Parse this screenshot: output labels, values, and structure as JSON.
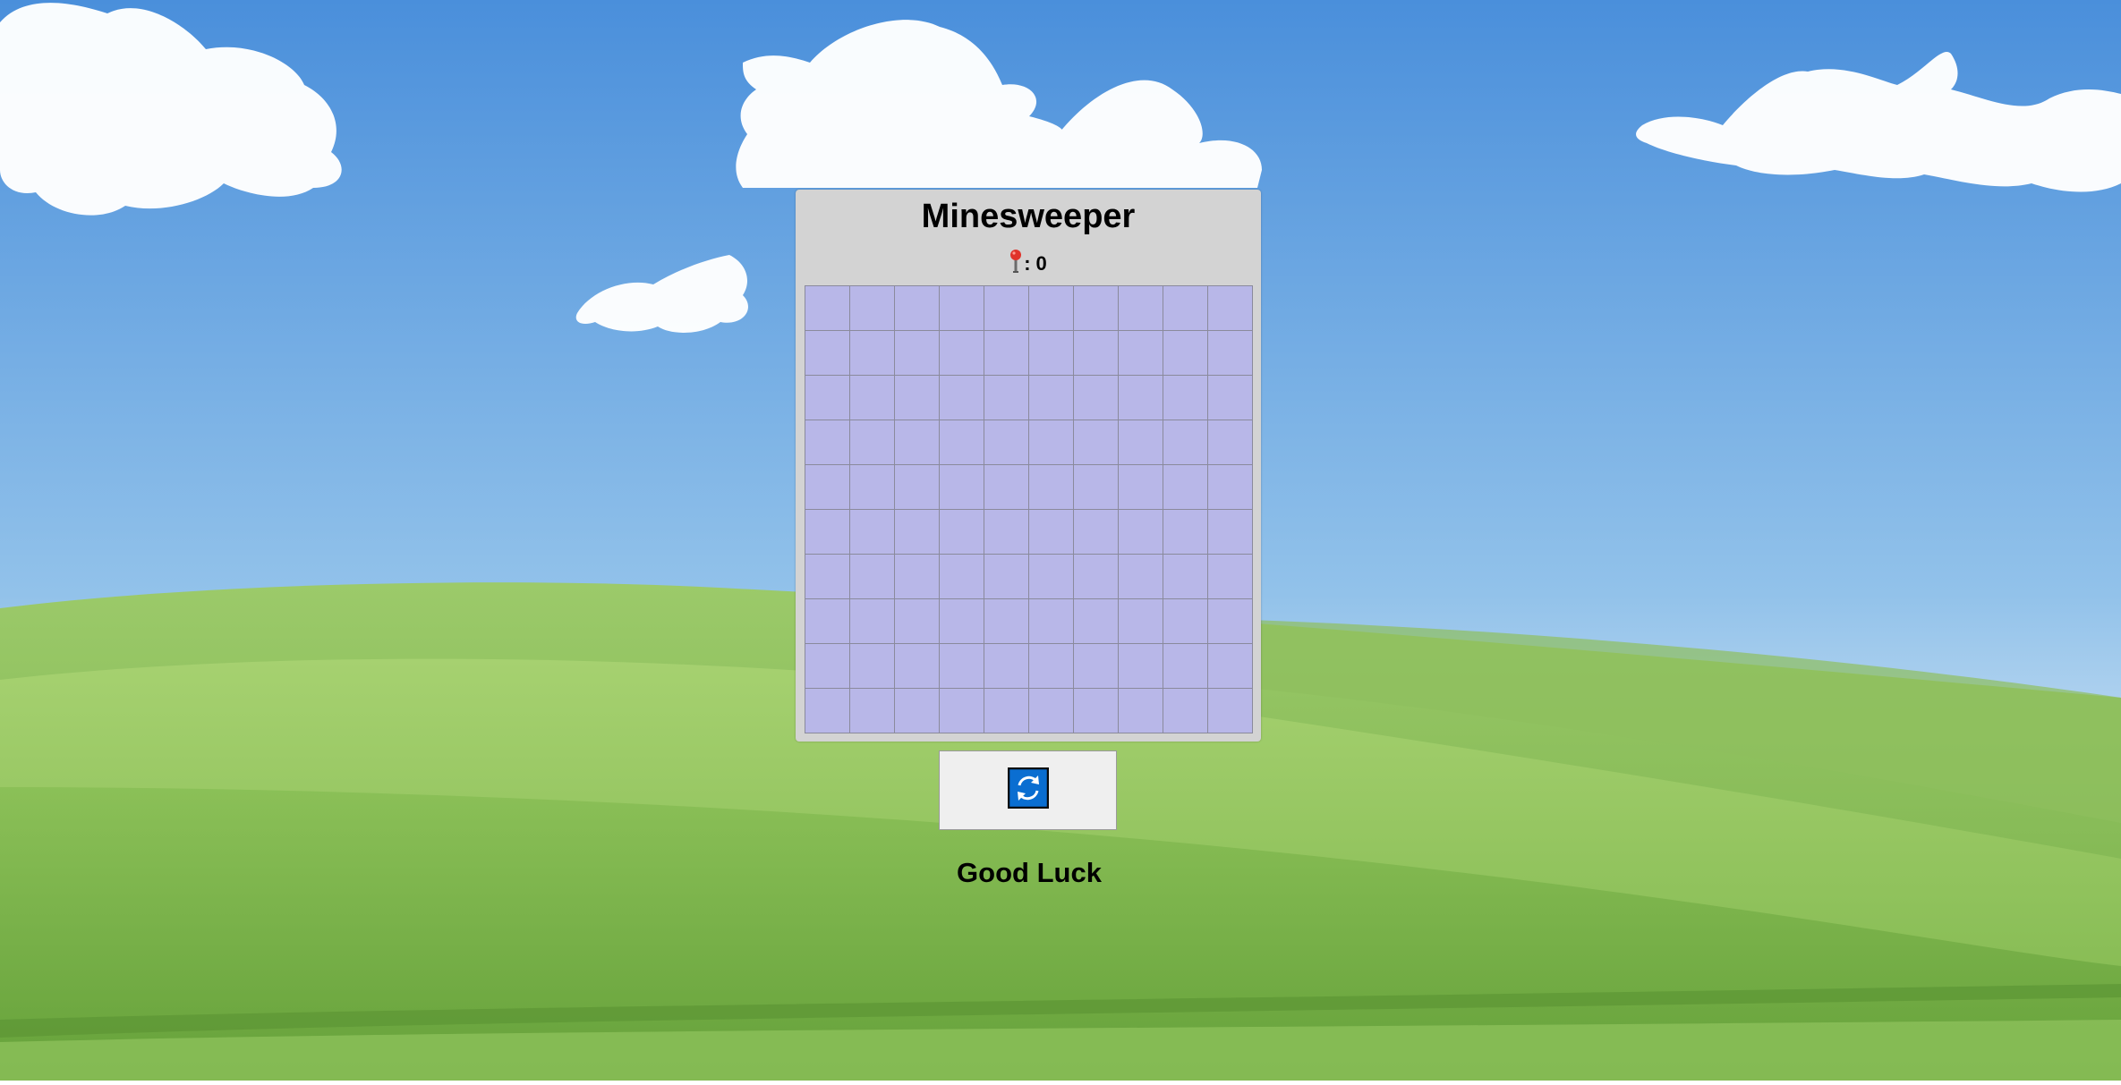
{
  "game": {
    "title": "Minesweeper",
    "flag_count": "0",
    "flag_separator": ":",
    "status": "Good Luck",
    "grid_rows": 10,
    "grid_cols": 10
  },
  "icons": {
    "flag": "flag-icon",
    "reset": "refresh-icon"
  },
  "colors": {
    "cell": "#b8b7e8",
    "panel": "#d3d3d3",
    "reset_icon": "#0a6ed1",
    "flag": "#e0332b"
  }
}
